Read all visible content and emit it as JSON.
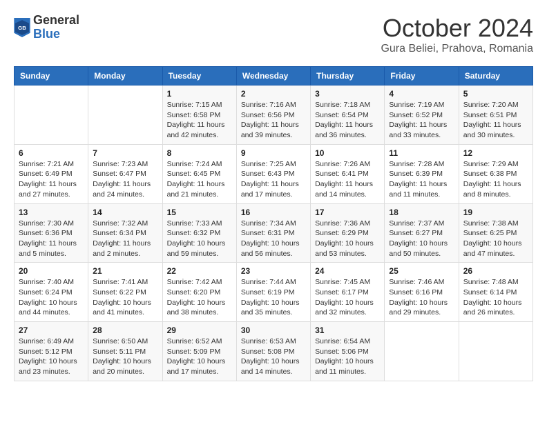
{
  "logo": {
    "general": "General",
    "blue": "Blue"
  },
  "title": "October 2024",
  "location": "Gura Beliei, Prahova, Romania",
  "days_of_week": [
    "Sunday",
    "Monday",
    "Tuesday",
    "Wednesday",
    "Thursday",
    "Friday",
    "Saturday"
  ],
  "weeks": [
    [
      {
        "day": "",
        "sunrise": "",
        "sunset": "",
        "daylight": ""
      },
      {
        "day": "",
        "sunrise": "",
        "sunset": "",
        "daylight": ""
      },
      {
        "day": "1",
        "sunrise": "Sunrise: 7:15 AM",
        "sunset": "Sunset: 6:58 PM",
        "daylight": "Daylight: 11 hours and 42 minutes."
      },
      {
        "day": "2",
        "sunrise": "Sunrise: 7:16 AM",
        "sunset": "Sunset: 6:56 PM",
        "daylight": "Daylight: 11 hours and 39 minutes."
      },
      {
        "day": "3",
        "sunrise": "Sunrise: 7:18 AM",
        "sunset": "Sunset: 6:54 PM",
        "daylight": "Daylight: 11 hours and 36 minutes."
      },
      {
        "day": "4",
        "sunrise": "Sunrise: 7:19 AM",
        "sunset": "Sunset: 6:52 PM",
        "daylight": "Daylight: 11 hours and 33 minutes."
      },
      {
        "day": "5",
        "sunrise": "Sunrise: 7:20 AM",
        "sunset": "Sunset: 6:51 PM",
        "daylight": "Daylight: 11 hours and 30 minutes."
      }
    ],
    [
      {
        "day": "6",
        "sunrise": "Sunrise: 7:21 AM",
        "sunset": "Sunset: 6:49 PM",
        "daylight": "Daylight: 11 hours and 27 minutes."
      },
      {
        "day": "7",
        "sunrise": "Sunrise: 7:23 AM",
        "sunset": "Sunset: 6:47 PM",
        "daylight": "Daylight: 11 hours and 24 minutes."
      },
      {
        "day": "8",
        "sunrise": "Sunrise: 7:24 AM",
        "sunset": "Sunset: 6:45 PM",
        "daylight": "Daylight: 11 hours and 21 minutes."
      },
      {
        "day": "9",
        "sunrise": "Sunrise: 7:25 AM",
        "sunset": "Sunset: 6:43 PM",
        "daylight": "Daylight: 11 hours and 17 minutes."
      },
      {
        "day": "10",
        "sunrise": "Sunrise: 7:26 AM",
        "sunset": "Sunset: 6:41 PM",
        "daylight": "Daylight: 11 hours and 14 minutes."
      },
      {
        "day": "11",
        "sunrise": "Sunrise: 7:28 AM",
        "sunset": "Sunset: 6:39 PM",
        "daylight": "Daylight: 11 hours and 11 minutes."
      },
      {
        "day": "12",
        "sunrise": "Sunrise: 7:29 AM",
        "sunset": "Sunset: 6:38 PM",
        "daylight": "Daylight: 11 hours and 8 minutes."
      }
    ],
    [
      {
        "day": "13",
        "sunrise": "Sunrise: 7:30 AM",
        "sunset": "Sunset: 6:36 PM",
        "daylight": "Daylight: 11 hours and 5 minutes."
      },
      {
        "day": "14",
        "sunrise": "Sunrise: 7:32 AM",
        "sunset": "Sunset: 6:34 PM",
        "daylight": "Daylight: 11 hours and 2 minutes."
      },
      {
        "day": "15",
        "sunrise": "Sunrise: 7:33 AM",
        "sunset": "Sunset: 6:32 PM",
        "daylight": "Daylight: 10 hours and 59 minutes."
      },
      {
        "day": "16",
        "sunrise": "Sunrise: 7:34 AM",
        "sunset": "Sunset: 6:31 PM",
        "daylight": "Daylight: 10 hours and 56 minutes."
      },
      {
        "day": "17",
        "sunrise": "Sunrise: 7:36 AM",
        "sunset": "Sunset: 6:29 PM",
        "daylight": "Daylight: 10 hours and 53 minutes."
      },
      {
        "day": "18",
        "sunrise": "Sunrise: 7:37 AM",
        "sunset": "Sunset: 6:27 PM",
        "daylight": "Daylight: 10 hours and 50 minutes."
      },
      {
        "day": "19",
        "sunrise": "Sunrise: 7:38 AM",
        "sunset": "Sunset: 6:25 PM",
        "daylight": "Daylight: 10 hours and 47 minutes."
      }
    ],
    [
      {
        "day": "20",
        "sunrise": "Sunrise: 7:40 AM",
        "sunset": "Sunset: 6:24 PM",
        "daylight": "Daylight: 10 hours and 44 minutes."
      },
      {
        "day": "21",
        "sunrise": "Sunrise: 7:41 AM",
        "sunset": "Sunset: 6:22 PM",
        "daylight": "Daylight: 10 hours and 41 minutes."
      },
      {
        "day": "22",
        "sunrise": "Sunrise: 7:42 AM",
        "sunset": "Sunset: 6:20 PM",
        "daylight": "Daylight: 10 hours and 38 minutes."
      },
      {
        "day": "23",
        "sunrise": "Sunrise: 7:44 AM",
        "sunset": "Sunset: 6:19 PM",
        "daylight": "Daylight: 10 hours and 35 minutes."
      },
      {
        "day": "24",
        "sunrise": "Sunrise: 7:45 AM",
        "sunset": "Sunset: 6:17 PM",
        "daylight": "Daylight: 10 hours and 32 minutes."
      },
      {
        "day": "25",
        "sunrise": "Sunrise: 7:46 AM",
        "sunset": "Sunset: 6:16 PM",
        "daylight": "Daylight: 10 hours and 29 minutes."
      },
      {
        "day": "26",
        "sunrise": "Sunrise: 7:48 AM",
        "sunset": "Sunset: 6:14 PM",
        "daylight": "Daylight: 10 hours and 26 minutes."
      }
    ],
    [
      {
        "day": "27",
        "sunrise": "Sunrise: 6:49 AM",
        "sunset": "Sunset: 5:12 PM",
        "daylight": "Daylight: 10 hours and 23 minutes."
      },
      {
        "day": "28",
        "sunrise": "Sunrise: 6:50 AM",
        "sunset": "Sunset: 5:11 PM",
        "daylight": "Daylight: 10 hours and 20 minutes."
      },
      {
        "day": "29",
        "sunrise": "Sunrise: 6:52 AM",
        "sunset": "Sunset: 5:09 PM",
        "daylight": "Daylight: 10 hours and 17 minutes."
      },
      {
        "day": "30",
        "sunrise": "Sunrise: 6:53 AM",
        "sunset": "Sunset: 5:08 PM",
        "daylight": "Daylight: 10 hours and 14 minutes."
      },
      {
        "day": "31",
        "sunrise": "Sunrise: 6:54 AM",
        "sunset": "Sunset: 5:06 PM",
        "daylight": "Daylight: 10 hours and 11 minutes."
      },
      {
        "day": "",
        "sunrise": "",
        "sunset": "",
        "daylight": ""
      },
      {
        "day": "",
        "sunrise": "",
        "sunset": "",
        "daylight": ""
      }
    ]
  ]
}
